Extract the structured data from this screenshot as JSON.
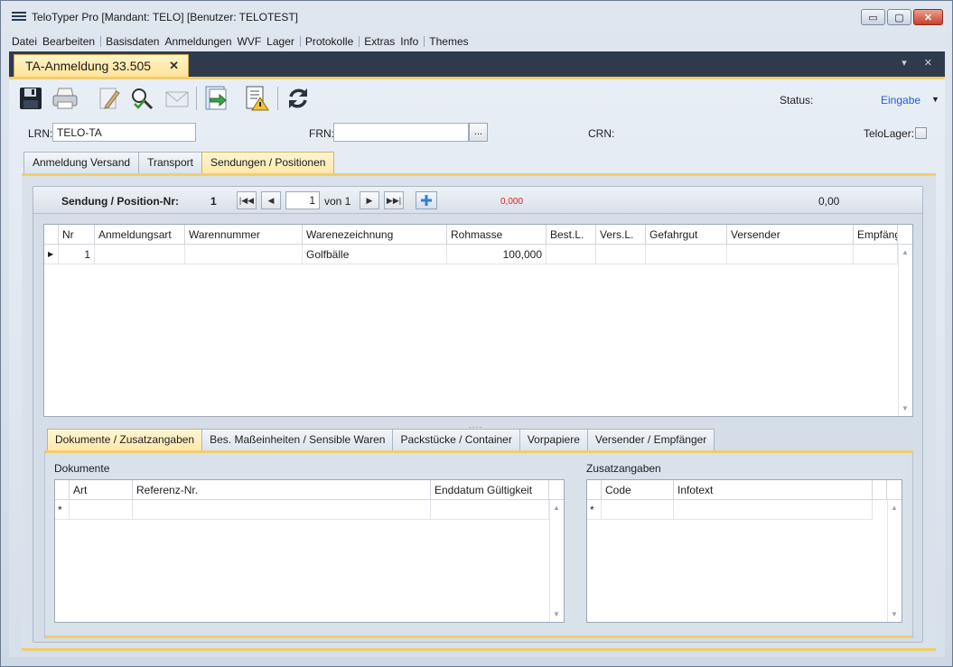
{
  "window": {
    "title": "TeloTyper Pro  [Mandant: TELO]  [Benutzer: TELOTEST]",
    "minimize": "▭",
    "restore": "▢",
    "close": "✕"
  },
  "menu": [
    "Datei",
    "Bearbeiten",
    "Basisdaten",
    "Anmeldungen",
    "WVF",
    "Lager",
    "Protokolle",
    "Extras",
    "Info",
    "Themes"
  ],
  "doc_tab": {
    "label": "TA-Anmeldung 33.505",
    "close": "✕"
  },
  "tabstrip_controls": "▾ ✕",
  "toolbar": {
    "icons": [
      "save-icon",
      "print-icon",
      "edit-icon",
      "search-check-icon",
      "mail-icon",
      "export-icon",
      "report-warning-icon",
      "refresh-icon"
    ],
    "status_label": "Status:",
    "status_value": "Eingabe",
    "status_dropdown": "▼"
  },
  "header": {
    "lrn_label": "LRN:",
    "lrn_value": "TELO-TA",
    "frn_label": "FRN:",
    "frn_value": "",
    "frn_button": "...",
    "crn_label": "CRN:",
    "telolager_label": "TeloLager:"
  },
  "main_tabs": [
    "Anmeldung Versand",
    "Transport",
    "Sendungen / Positionen"
  ],
  "navigator": {
    "label": "Sendung / Position-Nr:",
    "number": "1",
    "page": "1",
    "of": "von 1",
    "red_value": "0,000",
    "sum_value": "0,00"
  },
  "positions_table": {
    "columns": [
      "Nr",
      "Anmeldungsart",
      "Warennummer",
      "Warenezeichnung",
      "Rohmasse",
      "Best.L.",
      "Vers.L.",
      "Gefahrgut",
      "Versender",
      "Empfäng"
    ],
    "rows": [
      [
        "1",
        "",
        "",
        "Golfbälle",
        "100,000",
        "",
        "",
        "",
        "",
        ""
      ]
    ]
  },
  "splitter": "....",
  "bottom_tabs": [
    "Dokumente / Zusatzangaben",
    "Bes. Maßeinheiten / Sensible Waren",
    "Packstücke / Container",
    "Vorpapiere",
    "Versender / Empfänger"
  ],
  "documents": {
    "title": "Dokumente",
    "columns": [
      "Art",
      "Referenz-Nr.",
      "Enddatum Gültigkeit"
    ],
    "new_row_marker": "*"
  },
  "additional": {
    "title": "Zusatzangaben",
    "columns": [
      "Code",
      "Infotext"
    ],
    "new_row_marker": "*"
  }
}
